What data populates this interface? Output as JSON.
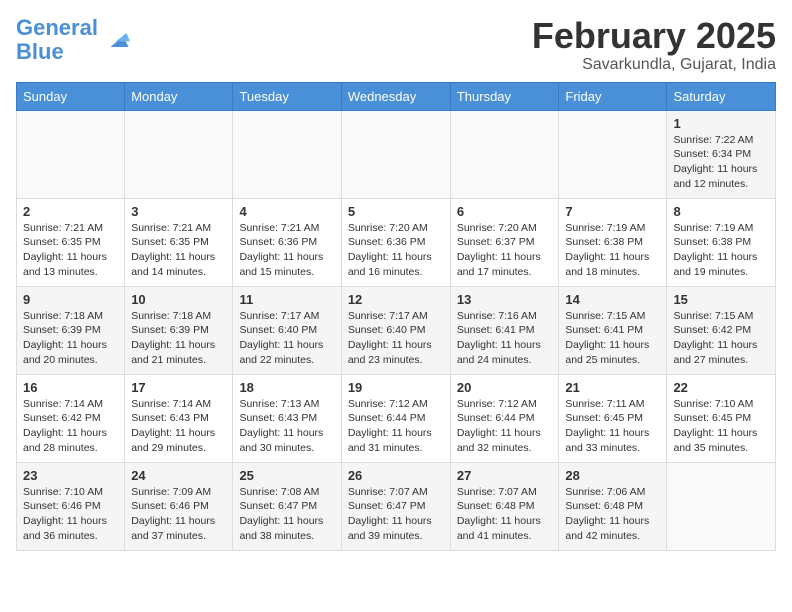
{
  "header": {
    "logo_line1": "General",
    "logo_line2": "Blue",
    "month_title": "February 2025",
    "location": "Savarkundla, Gujarat, India"
  },
  "days_of_week": [
    "Sunday",
    "Monday",
    "Tuesday",
    "Wednesday",
    "Thursday",
    "Friday",
    "Saturday"
  ],
  "weeks": [
    [
      {
        "day": "",
        "info": ""
      },
      {
        "day": "",
        "info": ""
      },
      {
        "day": "",
        "info": ""
      },
      {
        "day": "",
        "info": ""
      },
      {
        "day": "",
        "info": ""
      },
      {
        "day": "",
        "info": ""
      },
      {
        "day": "1",
        "info": "Sunrise: 7:22 AM\nSunset: 6:34 PM\nDaylight: 11 hours\nand 12 minutes."
      }
    ],
    [
      {
        "day": "2",
        "info": "Sunrise: 7:21 AM\nSunset: 6:35 PM\nDaylight: 11 hours\nand 13 minutes."
      },
      {
        "day": "3",
        "info": "Sunrise: 7:21 AM\nSunset: 6:35 PM\nDaylight: 11 hours\nand 14 minutes."
      },
      {
        "day": "4",
        "info": "Sunrise: 7:21 AM\nSunset: 6:36 PM\nDaylight: 11 hours\nand 15 minutes."
      },
      {
        "day": "5",
        "info": "Sunrise: 7:20 AM\nSunset: 6:36 PM\nDaylight: 11 hours\nand 16 minutes."
      },
      {
        "day": "6",
        "info": "Sunrise: 7:20 AM\nSunset: 6:37 PM\nDaylight: 11 hours\nand 17 minutes."
      },
      {
        "day": "7",
        "info": "Sunrise: 7:19 AM\nSunset: 6:38 PM\nDaylight: 11 hours\nand 18 minutes."
      },
      {
        "day": "8",
        "info": "Sunrise: 7:19 AM\nSunset: 6:38 PM\nDaylight: 11 hours\nand 19 minutes."
      }
    ],
    [
      {
        "day": "9",
        "info": "Sunrise: 7:18 AM\nSunset: 6:39 PM\nDaylight: 11 hours\nand 20 minutes."
      },
      {
        "day": "10",
        "info": "Sunrise: 7:18 AM\nSunset: 6:39 PM\nDaylight: 11 hours\nand 21 minutes."
      },
      {
        "day": "11",
        "info": "Sunrise: 7:17 AM\nSunset: 6:40 PM\nDaylight: 11 hours\nand 22 minutes."
      },
      {
        "day": "12",
        "info": "Sunrise: 7:17 AM\nSunset: 6:40 PM\nDaylight: 11 hours\nand 23 minutes."
      },
      {
        "day": "13",
        "info": "Sunrise: 7:16 AM\nSunset: 6:41 PM\nDaylight: 11 hours\nand 24 minutes."
      },
      {
        "day": "14",
        "info": "Sunrise: 7:15 AM\nSunset: 6:41 PM\nDaylight: 11 hours\nand 25 minutes."
      },
      {
        "day": "15",
        "info": "Sunrise: 7:15 AM\nSunset: 6:42 PM\nDaylight: 11 hours\nand 27 minutes."
      }
    ],
    [
      {
        "day": "16",
        "info": "Sunrise: 7:14 AM\nSunset: 6:42 PM\nDaylight: 11 hours\nand 28 minutes."
      },
      {
        "day": "17",
        "info": "Sunrise: 7:14 AM\nSunset: 6:43 PM\nDaylight: 11 hours\nand 29 minutes."
      },
      {
        "day": "18",
        "info": "Sunrise: 7:13 AM\nSunset: 6:43 PM\nDaylight: 11 hours\nand 30 minutes."
      },
      {
        "day": "19",
        "info": "Sunrise: 7:12 AM\nSunset: 6:44 PM\nDaylight: 11 hours\nand 31 minutes."
      },
      {
        "day": "20",
        "info": "Sunrise: 7:12 AM\nSunset: 6:44 PM\nDaylight: 11 hours\nand 32 minutes."
      },
      {
        "day": "21",
        "info": "Sunrise: 7:11 AM\nSunset: 6:45 PM\nDaylight: 11 hours\nand 33 minutes."
      },
      {
        "day": "22",
        "info": "Sunrise: 7:10 AM\nSunset: 6:45 PM\nDaylight: 11 hours\nand 35 minutes."
      }
    ],
    [
      {
        "day": "23",
        "info": "Sunrise: 7:10 AM\nSunset: 6:46 PM\nDaylight: 11 hours\nand 36 minutes."
      },
      {
        "day": "24",
        "info": "Sunrise: 7:09 AM\nSunset: 6:46 PM\nDaylight: 11 hours\nand 37 minutes."
      },
      {
        "day": "25",
        "info": "Sunrise: 7:08 AM\nSunset: 6:47 PM\nDaylight: 11 hours\nand 38 minutes."
      },
      {
        "day": "26",
        "info": "Sunrise: 7:07 AM\nSunset: 6:47 PM\nDaylight: 11 hours\nand 39 minutes."
      },
      {
        "day": "27",
        "info": "Sunrise: 7:07 AM\nSunset: 6:48 PM\nDaylight: 11 hours\nand 41 minutes."
      },
      {
        "day": "28",
        "info": "Sunrise: 7:06 AM\nSunset: 6:48 PM\nDaylight: 11 hours\nand 42 minutes."
      },
      {
        "day": "",
        "info": ""
      }
    ]
  ]
}
